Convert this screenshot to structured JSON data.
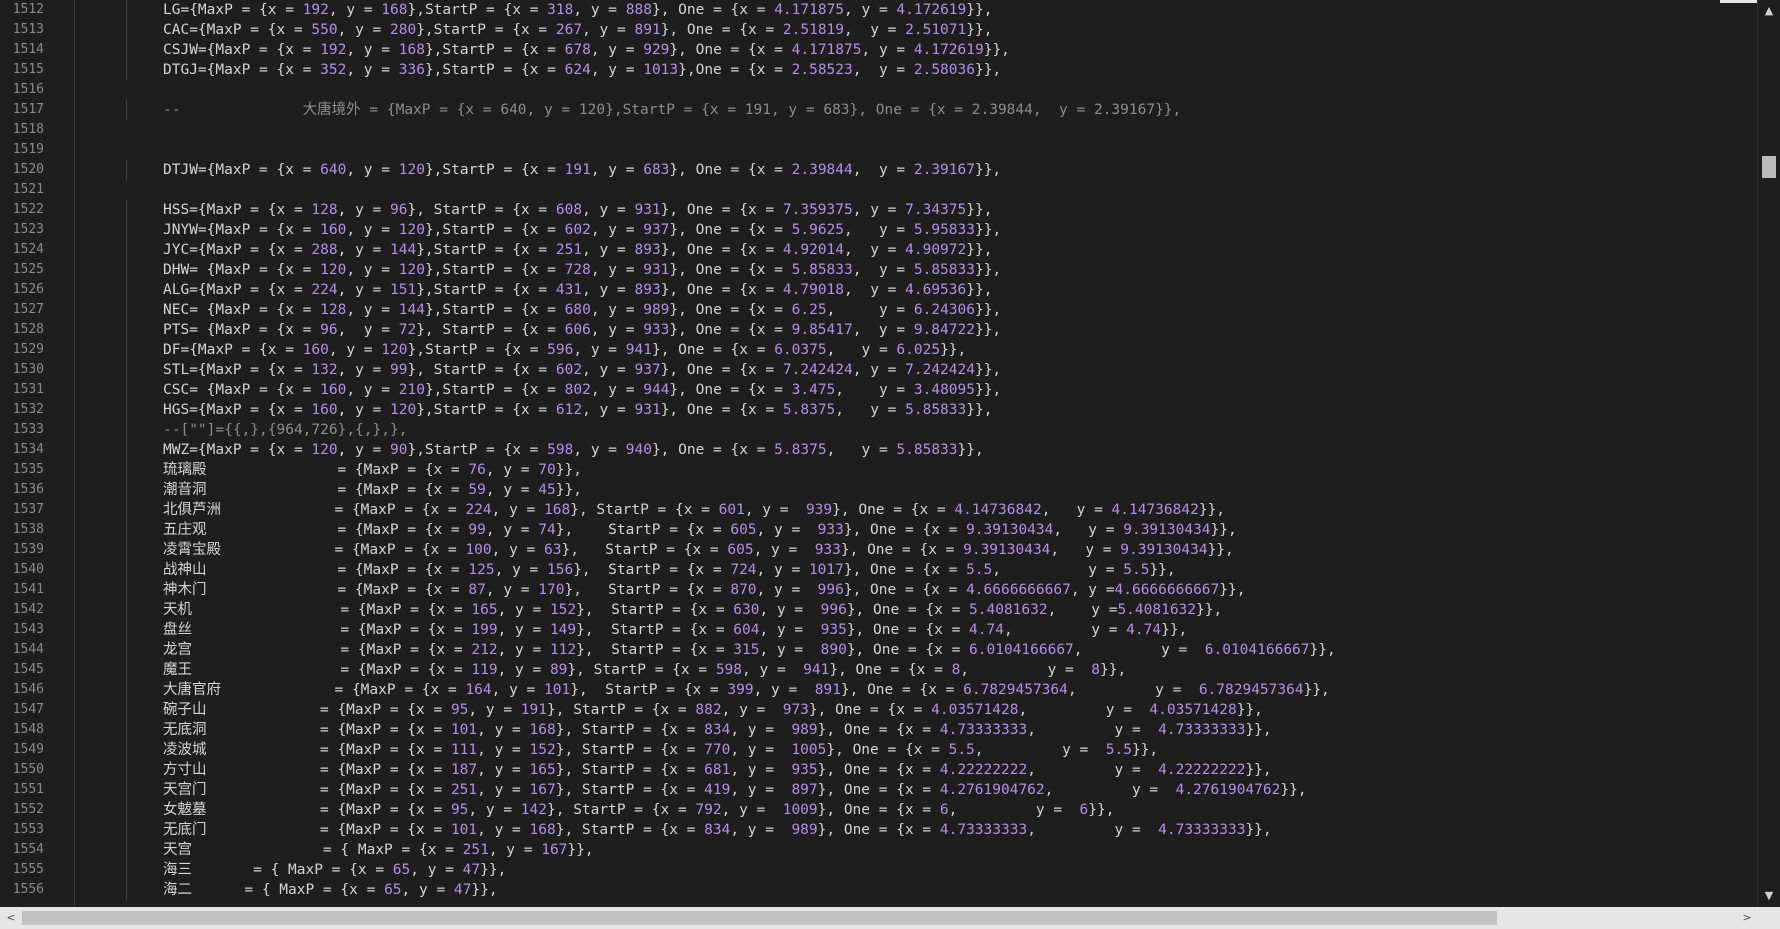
{
  "lines": [
    {
      "n": "1512",
      "t": "LG={MaxP = {x = 192, y = 168},StartP = {x = 318, y = 888}, One = {x = 4.171875, y = 4.172619}},"
    },
    {
      "n": "1513",
      "t": "CAC={MaxP = {x = 550, y = 280},StartP = {x = 267, y = 891}, One = {x = 2.51819,  y = 2.51071}},"
    },
    {
      "n": "1514",
      "t": "CSJW={MaxP = {x = 192, y = 168},StartP = {x = 678, y = 929}, One = {x = 4.171875, y = 4.172619}},"
    },
    {
      "n": "1515",
      "t": "DTGJ={MaxP = {x = 352, y = 336},StartP = {x = 624, y = 1013},One = {x = 2.58523,  y = 2.58036}},"
    },
    {
      "n": "1516",
      "t": ""
    },
    {
      "n": "1517",
      "t": "--              大唐境外 = {MaxP = {x = 640, y = 120},StartP = {x = 191, y = 683}, One = {x = 2.39844,  y = 2.39167}},",
      "c": true
    },
    {
      "n": "1518",
      "t": ""
    },
    {
      "n": "1519",
      "t": ""
    },
    {
      "n": "1520",
      "t": "DTJW={MaxP = {x = 640, y = 120},StartP = {x = 191, y = 683}, One = {x = 2.39844,  y = 2.39167}},"
    },
    {
      "n": "1521",
      "t": ""
    },
    {
      "n": "1522",
      "t": "HSS={MaxP = {x = 128, y = 96}, StartP = {x = 608, y = 931}, One = {x = 7.359375, y = 7.34375}},"
    },
    {
      "n": "1523",
      "t": "JNYW={MaxP = {x = 160, y = 120},StartP = {x = 602, y = 937}, One = {x = 5.9625,   y = 5.95833}},"
    },
    {
      "n": "1524",
      "t": "JYC={MaxP = {x = 288, y = 144},StartP = {x = 251, y = 893}, One = {x = 4.92014,  y = 4.90972}},"
    },
    {
      "n": "1525",
      "t": "DHW= {MaxP = {x = 120, y = 120},StartP = {x = 728, y = 931}, One = {x = 5.85833,  y = 5.85833}},"
    },
    {
      "n": "1526",
      "t": "ALG={MaxP = {x = 224, y = 151},StartP = {x = 431, y = 893}, One = {x = 4.79018,  y = 4.69536}},"
    },
    {
      "n": "1527",
      "t": "NEC= {MaxP = {x = 128, y = 144},StartP = {x = 680, y = 989}, One = {x = 6.25,     y = 6.24306}},"
    },
    {
      "n": "1528",
      "t": "PTS= {MaxP = {x = 96,  y = 72}, StartP = {x = 606, y = 933}, One = {x = 9.85417,  y = 9.84722}},"
    },
    {
      "n": "1529",
      "t": "DF={MaxP = {x = 160, y = 120},StartP = {x = 596, y = 941}, One = {x = 6.0375,   y = 6.025}},"
    },
    {
      "n": "1530",
      "t": "STL={MaxP = {x = 132, y = 99}, StartP = {x = 602, y = 937}, One = {x = 7.242424, y = 7.242424}},"
    },
    {
      "n": "1531",
      "t": "CSC= {MaxP = {x = 160, y = 210},StartP = {x = 802, y = 944}, One = {x = 3.475,    y = 3.48095}},"
    },
    {
      "n": "1532",
      "t": "HGS={MaxP = {x = 160, y = 120},StartP = {x = 612, y = 931}, One = {x = 5.8375,   y = 5.85833}},"
    },
    {
      "n": "1533",
      "t": "--[\"\"]={{,},{964,726},{,},},",
      "c": true
    },
    {
      "n": "1534",
      "t": "MWZ={MaxP = {x = 120, y = 90},StartP = {x = 598, y = 940}, One = {x = 5.8375,   y = 5.85833}},"
    },
    {
      "n": "1535",
      "t": "琉璃殿               = {MaxP = {x = 76, y = 70}},"
    },
    {
      "n": "1536",
      "t": "潮音洞               = {MaxP = {x = 59, y = 45}},"
    },
    {
      "n": "1537",
      "t": "北俱芦洲             = {MaxP = {x = 224, y = 168}, StartP = {x = 601, y =  939}, One = {x = 4.14736842,   y = 4.14736842}},"
    },
    {
      "n": "1538",
      "t": "五庄观               = {MaxP = {x = 99, y = 74},    StartP = {x = 605, y =  933}, One = {x = 9.39130434,   y = 9.39130434}},"
    },
    {
      "n": "1539",
      "t": "凌霄宝殿             = {MaxP = {x = 100, y = 63},   StartP = {x = 605, y =  933}, One = {x = 9.39130434,   y = 9.39130434}},"
    },
    {
      "n": "1540",
      "t": "战神山               = {MaxP = {x = 125, y = 156},  StartP = {x = 724, y = 1017}, One = {x = 5.5,          y = 5.5}},"
    },
    {
      "n": "1541",
      "t": "神木门               = {MaxP = {x = 87, y = 170},   StartP = {x = 870, y =  996}, One = {x = 4.6666666667, y =4.6666666667}},"
    },
    {
      "n": "1542",
      "t": "天机                 = {MaxP = {x = 165, y = 152},  StartP = {x = 630, y =  996}, One = {x = 5.4081632,    y =5.4081632}},"
    },
    {
      "n": "1543",
      "t": "盘丝                 = {MaxP = {x = 199, y = 149},  StartP = {x = 604, y =  935}, One = {x = 4.74,         y = 4.74}},"
    },
    {
      "n": "1544",
      "t": "龙宫                 = {MaxP = {x = 212, y = 112},  StartP = {x = 315, y =  890}, One = {x = 6.0104166667,         y =  6.0104166667}},"
    },
    {
      "n": "1545",
      "t": "魔王                 = {MaxP = {x = 119, y = 89}, StartP = {x = 598, y =  941}, One = {x = 8,         y =  8}},"
    },
    {
      "n": "1546",
      "t": "大唐官府             = {MaxP = {x = 164, y = 101},  StartP = {x = 399, y =  891}, One = {x = 6.7829457364,         y =  6.7829457364}},"
    },
    {
      "n": "1547",
      "t": "碗子山             = {MaxP = {x = 95, y = 191}, StartP = {x = 882, y =  973}, One = {x = 4.03571428,         y =  4.03571428}},"
    },
    {
      "n": "1548",
      "t": "无底洞             = {MaxP = {x = 101, y = 168}, StartP = {x = 834, y =  989}, One = {x = 4.73333333,         y =  4.73333333}},"
    },
    {
      "n": "1549",
      "t": "凌波城             = {MaxP = {x = 111, y = 152}, StartP = {x = 770, y =  1005}, One = {x = 5.5,         y =  5.5}},"
    },
    {
      "n": "1550",
      "t": "方寸山             = {MaxP = {x = 187, y = 165}, StartP = {x = 681, y =  935}, One = {x = 4.22222222,         y =  4.22222222}},"
    },
    {
      "n": "1551",
      "t": "天宫门             = {MaxP = {x = 251, y = 167}, StartP = {x = 419, y =  897}, One = {x = 4.2761904762,         y =  4.2761904762}},"
    },
    {
      "n": "1552",
      "t": "女魃墓             = {MaxP = {x = 95, y = 142}, StartP = {x = 792, y =  1009}, One = {x = 6,         y =  6}},"
    },
    {
      "n": "1553",
      "t": "无底门             = {MaxP = {x = 101, y = 168}, StartP = {x = 834, y =  989}, One = {x = 4.73333333,         y =  4.73333333}},"
    },
    {
      "n": "1554",
      "t": "天宫               = { MaxP = {x = 251, y = 167}},"
    },
    {
      "n": "1555",
      "t": "海三       = { MaxP = {x = 65, y = 47}},"
    },
    {
      "n": "1556",
      "t": "海二      = { MaxP = {x = 65, y = 47}},"
    }
  ],
  "scrollbar": {
    "up_glyph": "▲",
    "down_glyph": "▼",
    "left_glyph": "<",
    "right_glyph": ">"
  },
  "colors": {
    "background": "#1e1e1e",
    "text": "#d4d4d4",
    "number": "#b48ee6",
    "line_number": "#8a8a8a",
    "comment": "#8c8c8c"
  }
}
